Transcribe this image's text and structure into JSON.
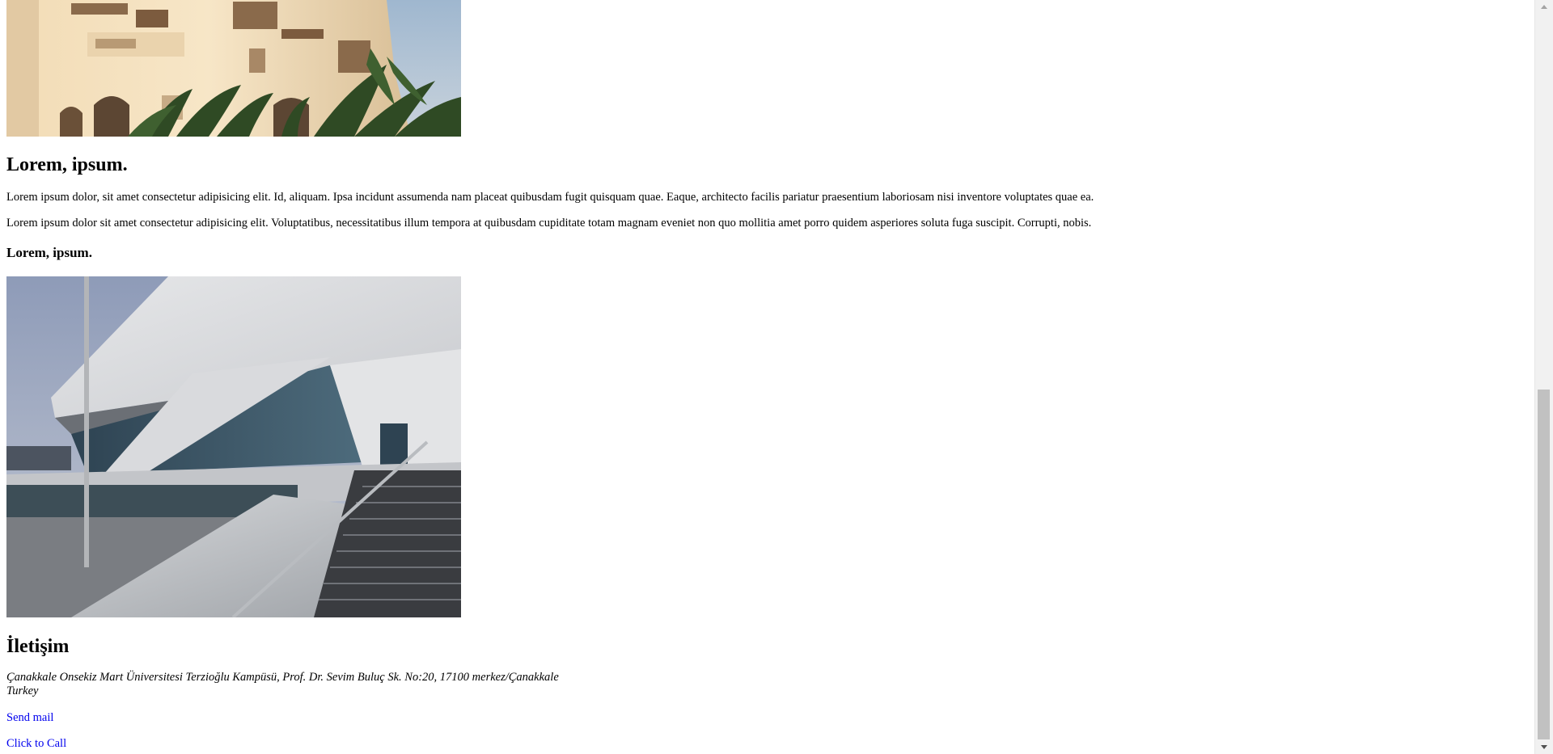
{
  "section1": {
    "heading": "Lorem, ipsum.",
    "paragraph1": "Lorem ipsum dolor, sit amet consectetur adipisicing elit. Id, aliquam. Ipsa incidunt assumenda nam placeat quibusdam fugit quisquam quae. Eaque, architecto facilis pariatur praesentium laboriosam nisi inventore voluptates quae ea.",
    "paragraph2": "Lorem ipsum dolor sit amet consectetur adipisicing elit. Voluptatibus, necessitatibus illum tempora at quibusdam cupiditate totam magnam eveniet non quo mollitia amet porro quidem asperiores soluta fuga suscipit. Corrupti, nobis.",
    "subheading": "Lorem, ipsum."
  },
  "contact": {
    "heading": "İletişim",
    "address_line1": "Çanakkale Onsekiz Mart Üniversitesi Terzioğlu Kampüsü, Prof. Dr. Sevim Buluç Sk. No:20, 17100 merkez/Çanakkale",
    "address_line2": "Turkey",
    "mail_link": "Send mail",
    "call_link": "Click to Call"
  },
  "colors": {
    "link": "#0000ee",
    "scrollbar_thumb": "#c1c1c1",
    "scrollbar_track": "#f1f1f1"
  },
  "scrollbar": {
    "scroll_fraction": 0.63
  }
}
